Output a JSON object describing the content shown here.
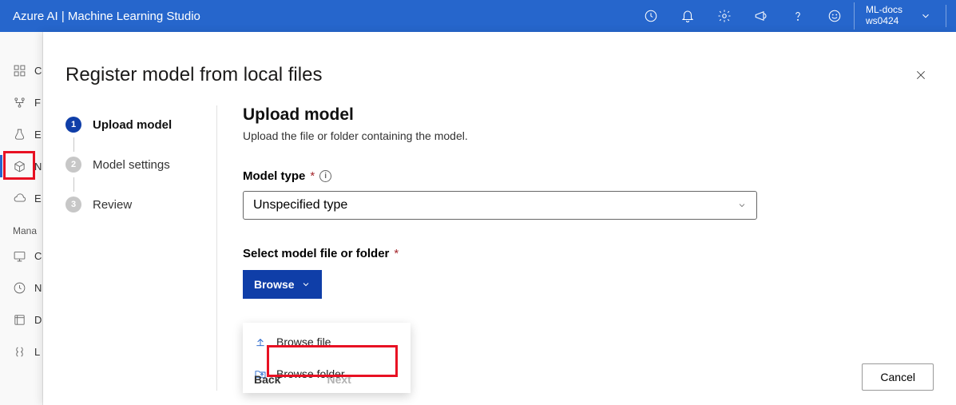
{
  "header": {
    "title": "Azure AI | Machine Learning Studio",
    "workspace_org": "ML-docs",
    "workspace_name": "ws0424"
  },
  "sidebar": {
    "items": [
      {
        "letter": "C"
      },
      {
        "letter": "F"
      },
      {
        "letter": "E"
      },
      {
        "letter": "N"
      },
      {
        "letter": "E"
      }
    ],
    "section_label": "Mana",
    "manage_items": [
      {
        "letter": "C"
      },
      {
        "letter": "N"
      },
      {
        "letter": "D"
      },
      {
        "letter": "L"
      }
    ]
  },
  "panel": {
    "title": "Register model from local files",
    "steps": [
      {
        "num": "1",
        "label": "Upload model"
      },
      {
        "num": "2",
        "label": "Model settings"
      },
      {
        "num": "3",
        "label": "Review"
      }
    ],
    "form": {
      "heading": "Upload model",
      "subheading": "Upload the file or folder containing the model.",
      "model_type_label": "Model type",
      "model_type_value": "Unspecified type",
      "select_label": "Select model file or folder",
      "browse_label": "Browse",
      "browse_file": "Browse file",
      "browse_folder": "Browse folder",
      "back": "Back",
      "next": "Next",
      "cancel": "Cancel"
    }
  }
}
